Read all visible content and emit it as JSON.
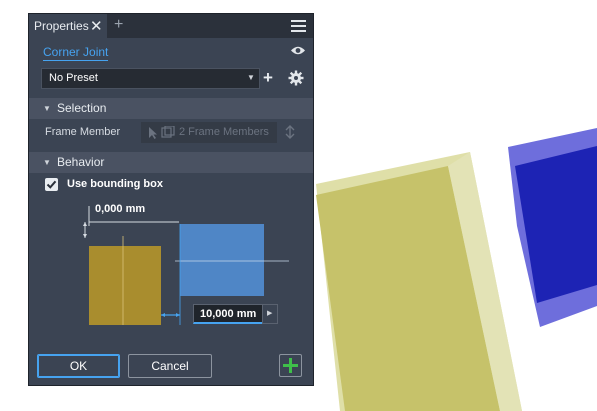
{
  "panel": {
    "tab_label": "Properties",
    "tab_close": "✕",
    "tab_add": "+",
    "feature_name": "Corner Joint",
    "preset": "No Preset",
    "sections": {
      "selection": "Selection",
      "behavior": "Behavior"
    },
    "frame_member_label": "Frame Member",
    "frame_member_value": "2 Frame Members",
    "checkbox_label": "Use bounding box",
    "checkbox_checked": true,
    "top_offset": "0,000 mm",
    "gap_value": "10,000 mm",
    "ok_label": "OK",
    "cancel_label": "Cancel"
  },
  "icons": {
    "close": "close-icon",
    "menu": "hamburger-menu-icon",
    "visibility": "eye-icon",
    "add_preset": "plus-icon",
    "settings": "gear-icon",
    "flip": "swap-icon",
    "apply": "green-plus-icon"
  },
  "colors": {
    "panel_bg": "#3b4453",
    "accent": "#46a3f0",
    "member_a": "#a98d2e",
    "member_b": "#4f86c6",
    "apply_green": "#3fbf4a",
    "viewport_yellow": "#c9c66a",
    "viewport_blue": "#2a2fbf"
  }
}
